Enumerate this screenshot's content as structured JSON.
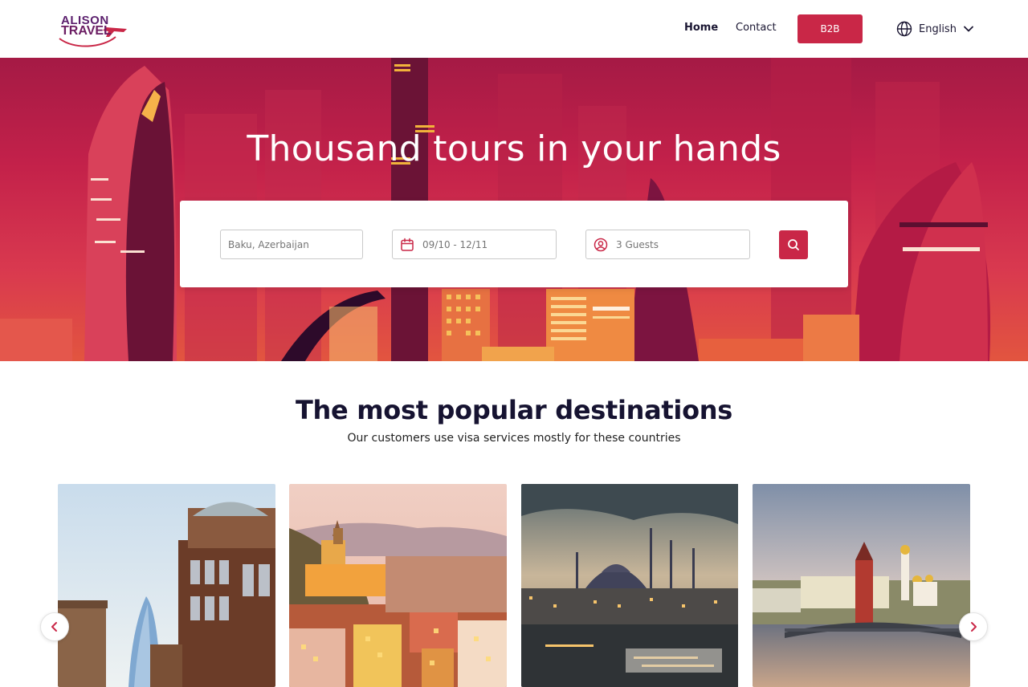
{
  "brand": {
    "logo_top": "ALISON",
    "logo_bottom": "TRAVEL",
    "primary_color": "#c92747",
    "text_color": "#161331"
  },
  "nav": {
    "home": "Home",
    "contact": "Contact",
    "b2b": "B2B",
    "language": "English"
  },
  "hero": {
    "title": "Thousand tours in your hands"
  },
  "search": {
    "location_placeholder": "Baku, Azerbaijan",
    "dates_placeholder": "09/10 - 12/11",
    "guests_placeholder": "3 Guests"
  },
  "destinations": {
    "title": "The most popular destinations",
    "subtitle": "Our customers use visa services mostly for these countries"
  },
  "icons": {
    "language": "globe-icon",
    "dropdown": "chevron-down-icon",
    "date": "calendar-icon",
    "guests": "user-circle-icon",
    "search": "search-icon",
    "prev": "chevron-left-icon",
    "next": "chevron-right-icon"
  }
}
